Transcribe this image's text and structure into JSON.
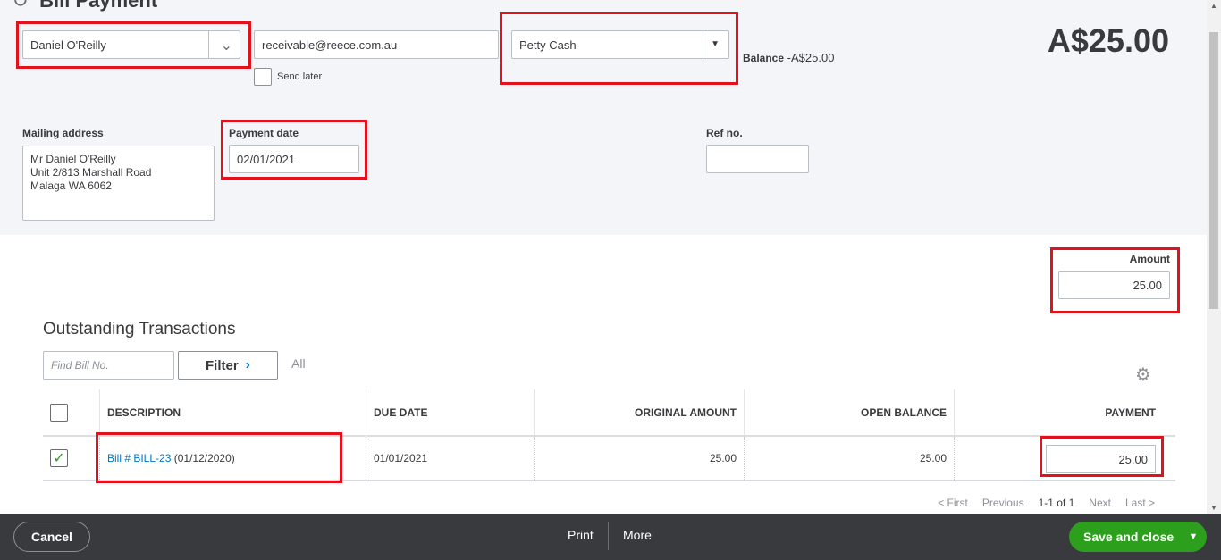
{
  "header": {
    "title": "Bill Payment",
    "amount_display": "A$25.00",
    "balance_label": "Balance",
    "balance_value": "-A$25.00"
  },
  "payee": {
    "selected": "Daniel O'Reilly"
  },
  "email": {
    "value": "receivable@reece.com.au"
  },
  "send_later": {
    "label": "Send later",
    "checked": false
  },
  "payment_account": {
    "selected": "Petty Cash"
  },
  "mailing_address": {
    "label": "Mailing address",
    "lines": [
      "Mr Daniel O'Reilly",
      "Unit 2/813 Marshall Road",
      "Malaga WA  6062"
    ]
  },
  "payment_date": {
    "label": "Payment date",
    "value": "02/01/2021"
  },
  "ref_no": {
    "label": "Ref no.",
    "value": ""
  },
  "amount": {
    "label": "Amount",
    "value": "25.00"
  },
  "outstanding": {
    "title": "Outstanding Transactions",
    "find_placeholder": "Find Bill No.",
    "filter_label": "Filter",
    "all_label": "All",
    "columns": [
      "DESCRIPTION",
      "DUE DATE",
      "ORIGINAL AMOUNT",
      "OPEN BALANCE",
      "PAYMENT"
    ],
    "rows": [
      {
        "checked": true,
        "description_link": "Bill # BILL-23",
        "description_date": "(01/12/2020)",
        "due_date": "01/01/2021",
        "original_amount": "25.00",
        "open_balance": "25.00",
        "payment": "25.00"
      }
    ],
    "pager": {
      "first": "< First",
      "previous": "Previous",
      "range": "1-1 of 1",
      "next": "Next",
      "last": "Last >"
    }
  },
  "footer": {
    "cancel": "Cancel",
    "print": "Print",
    "more": "More",
    "save_close": "Save and close"
  },
  "colors": {
    "accent_green": "#2ca01c",
    "link_blue": "#0077c5",
    "highlight_red": "#e3111c",
    "footer_bg": "#393a3d"
  }
}
